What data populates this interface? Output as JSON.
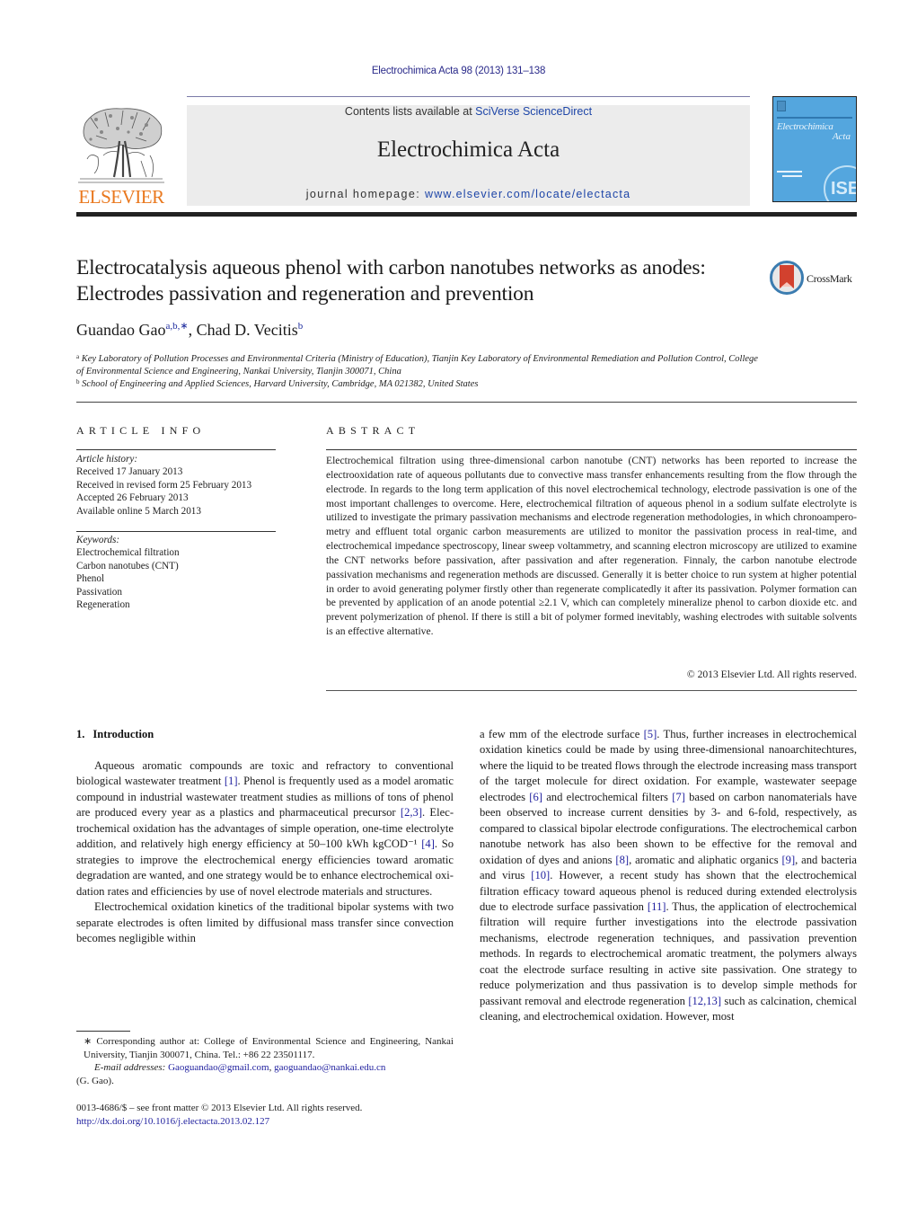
{
  "header": {
    "journal_ref": "Electrochimica Acta 98 (2013) 131–138",
    "contents_prefix": "Contents lists available at ",
    "contents_link": "SciVerse ScienceDirect",
    "journal_title": "Electrochimica Acta",
    "homepage_prefix": "journal homepage: ",
    "homepage_url": "www.elsevier.com/locate/electacta",
    "publisher_logo_text": "ELSEVIER",
    "cover": {
      "title_line1": "Electrochimica",
      "title_line2": "Acta",
      "badge": "ISE"
    },
    "colors": {
      "elsevier_orange": "#e9781e",
      "link_blue": "#1e46a8",
      "cover_blue": "#54a6de",
      "masthead_gray": "#ececec"
    }
  },
  "article": {
    "title": "Electrocatalysis aqueous phenol with carbon nanotubes networks as anodes: Electrodes passivation and regeneration and prevention",
    "crossmark_label": "CrossMark",
    "authors": [
      {
        "name": "Guandao Gao",
        "marks": "a,b,∗",
        "separator": ", "
      },
      {
        "name": "Chad D. Vecitis",
        "marks": "b",
        "separator": ""
      }
    ],
    "affiliations": [
      {
        "mark": "a",
        "text": "Key Laboratory of Pollution Processes and Environmental Criteria (Ministry of Education), Tianjin Key Laboratory of Environmental Remediation and Pollution Control, College of Environmental Science and Engineering, Nankai University, Tianjin 300071, China"
      },
      {
        "mark": "b",
        "text": "School of Engineering and Applied Sciences, Harvard University, Cambridge, MA 021382, United States"
      }
    ]
  },
  "article_info": {
    "heading": "ARTICLE INFO",
    "history_label": "Article history:",
    "history": [
      "Received 17 January 2013",
      "Received in revised form 25 February 2013",
      "Accepted 26 February 2013",
      "Available online 5 March 2013"
    ],
    "keywords_label": "Keywords:",
    "keywords": [
      "Electrochemical filtration",
      "Carbon nanotubes (CNT)",
      "Phenol",
      "Passivation",
      "Regeneration"
    ]
  },
  "abstract": {
    "heading": "ABSTRACT",
    "text": "Electrochemical filtration using three-dimensional carbon nanotube (CNT) networks has been reported to increase the electrooxidation rate of aqueous pollutants due to convective mass transfer enhancements resulting from the flow through the electrode. In regards to the long term application of this novel elec­trochemical technology, electrode passivation is one of the most important challenges to overcome. Here, electrochemical filtration of aqueous phenol in a sodium sulfate electrolyte is utilized to investigate the primary passivation mechanisms and electrode regeneration methodologies, in which chronoampero­metry and effluent total organic carbon measurements are utilized to monitor the passivation process in real-time, and electrochemical impedance spectroscopy, linear sweep voltammetry, and scanning elec­tron microscopy are utilized to examine the CNT networks before passivation, after passivation and after regeneration. Finnaly, the carbon nanotube electrode passivation mechanisms and regeneration methods are discussed. Generally it is better choice to run system at higher potential in order to avoid generating polymer firstly other than regenerate complicatedly it after its passivation. Polymer formation can be prevented by application of an anode potential ≥2.1 V, which can completely mineralize phenol to car­bon dioxide etc. and prevent polymerization of phenol. If there is still a bit of polymer formed inevitably, washing electrodes with suitable solvents is an effective alternative.",
    "copyright": "© 2013 Elsevier Ltd. All rights reserved."
  },
  "section": {
    "number": "1.",
    "title": "Introduction",
    "left_paragraphs": [
      [
        {
          "t": "Aqueous aromatic compounds are toxic and refractory to con­ventional biological wastewater treatment "
        },
        {
          "ref": "[1]"
        },
        {
          "t": ". Phenol is frequently used as a model aromatic compound in industrial wastewater treatment studies as millions of tons of phenol are produced every year as a plastics and pharmaceutical precursor "
        },
        {
          "ref": "[2,3]"
        },
        {
          "t": ". Elec­trochemical oxidation has the advantages of simple operation, one-time electrolyte addition, and relatively high energy efficiency at 50–100 kWh kgCOD⁻¹ "
        },
        {
          "ref": "[4]"
        },
        {
          "t": ". So strategies to improve the elec­trochemical energy efficiencies toward aromatic degradation are wanted, and one strategy would be to enhance electrochemical oxi­dation rates and efficiencies by use of novel electrode materials and structures."
        }
      ],
      [
        {
          "t": "Electrochemical oxidation kinetics of the traditional bipolar systems with two separate electrodes is often limited by diffus­ional mass transfer since convection becomes negligible within"
        }
      ]
    ],
    "right_paragraphs": [
      [
        {
          "t": "a few mm of the electrode surface "
        },
        {
          "ref": "[5]"
        },
        {
          "t": ". Thus, further increases in electrochemical oxidation kinetics could be made by using three-dimensional nanoarchitechtures, where the liquid to be treated flows through the electrode increasing mass transport of the tar­get molecule for direct oxidation. For example, wastewater seepage electrodes "
        },
        {
          "ref": "[6]"
        },
        {
          "t": " and electrochemical filters "
        },
        {
          "ref": "[7]"
        },
        {
          "t": " based on carbon nano­materials have been observed to increase current densities by 3- and 6-fold, respectively, as compared to classical bipolar electrode configurations. The electrochemical carbon nanotube network has also been shown to be effective for the removal and oxidation of dyes and anions "
        },
        {
          "ref": "[8]"
        },
        {
          "t": ", aromatic and aliphatic organics "
        },
        {
          "ref": "[9]"
        },
        {
          "t": ", and bacteria and virus "
        },
        {
          "ref": "[10]"
        },
        {
          "t": ". However, a recent study has shown that the electrochemical filtration efficacy toward aqueous phenol is reduced during extended electrolysis due to electrode surface pas­sivation "
        },
        {
          "ref": "[11]"
        },
        {
          "t": ". Thus, the application of electrochemical filtration will require further investigations into the electrode passivation mechanisms, electrode regeneration techniques, and passivation prevention methods. In regards to electrochemical aromatic treat­ment, the polymers always coat the electrode surface resulting in active site passivation. One strategy to reduce polymerization and thus passivation is to develop simple methods for passivant removal and electrode regeneration "
        },
        {
          "ref": "[12,13]"
        },
        {
          "t": " such as calcination, chemical cleaning, and electrochemical oxidation. However, most"
        }
      ]
    ]
  },
  "footnotes": {
    "corresponding": "∗ Corresponding author at: College of Environmental Science and Engineering, Nankai University, Tianjin 300071, China. Tel.: +86 22 23501117.",
    "email_label": "E-mail addresses: ",
    "emails": [
      "Gaoguandao@gmail.com",
      "gaoguandao@nankai.edu.cn"
    ],
    "email_owner": "(G. Gao).",
    "issn_line": "0013-4686/$ – see front matter © 2013 Elsevier Ltd. All rights reserved.",
    "doi": "http://dx.doi.org/10.1016/j.electacta.2013.02.127"
  }
}
